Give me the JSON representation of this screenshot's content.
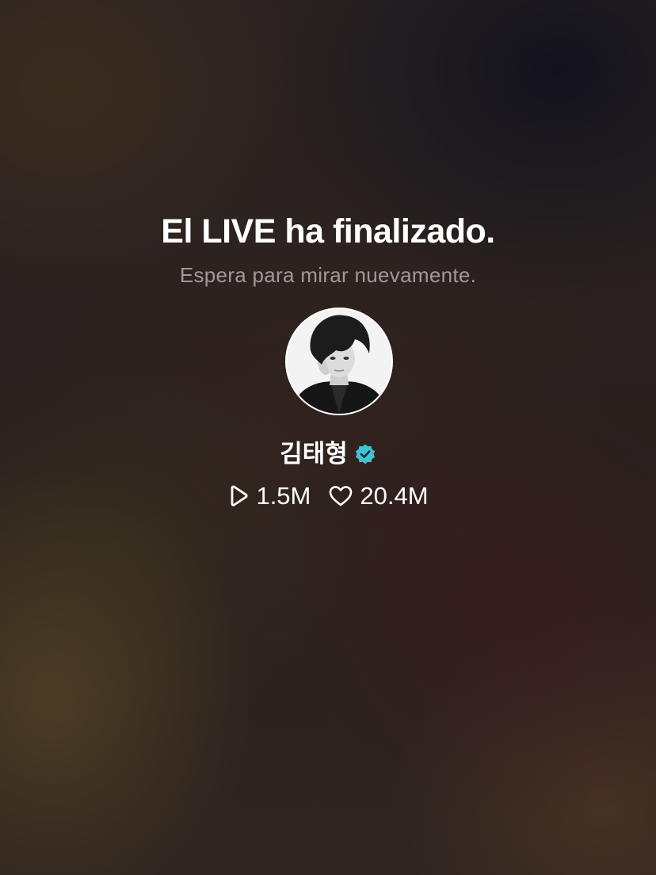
{
  "live_ended": {
    "title": "El LIVE ha finalizado.",
    "subtitle": "Espera para mirar nuevamente."
  },
  "profile": {
    "name": "김태형",
    "verified": true,
    "verified_color": "#3ec4d6",
    "avatar_icon": "profile-photo"
  },
  "stats": {
    "plays_icon": "play-outline-icon",
    "plays": "1.5M",
    "likes_icon": "heart-outline-icon",
    "likes": "20.4M"
  }
}
